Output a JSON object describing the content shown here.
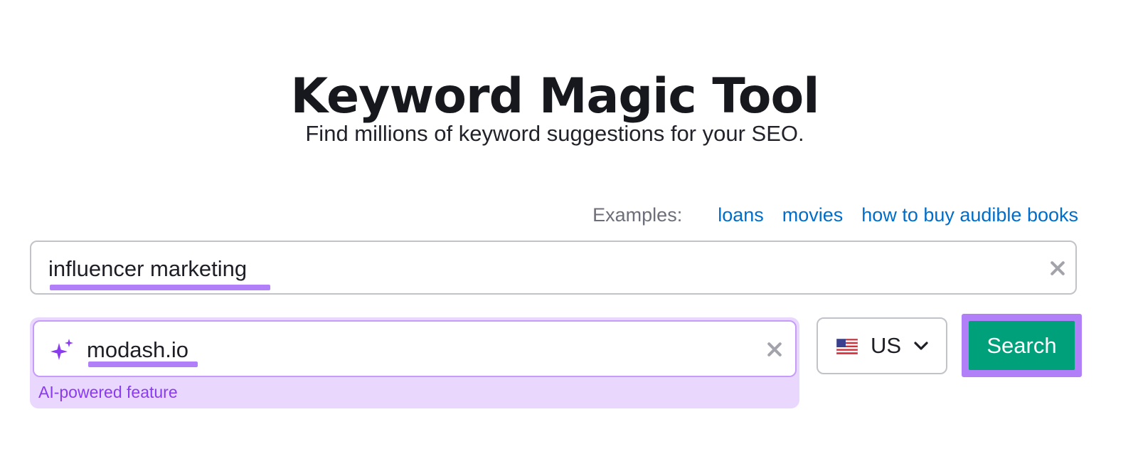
{
  "header": {
    "title": "Keyword Magic Tool",
    "subtitle": "Find millions of keyword suggestions for your SEO."
  },
  "examples": {
    "label": "Examples:",
    "links": [
      "loans",
      "movies",
      "how to buy audible books"
    ]
  },
  "keyword_input": {
    "value": "influencer marketing",
    "clear_icon": "close-icon"
  },
  "domain_input": {
    "value": "modash.io",
    "icon": "sparkle-icon",
    "clear_icon": "close-icon",
    "caption": "AI-powered feature"
  },
  "country_select": {
    "selected": "US",
    "flag_icon": "us-flag-icon",
    "chevron_icon": "chevron-down-icon"
  },
  "search_button": {
    "label": "Search"
  },
  "colors": {
    "accent_highlight": "#b17ff8",
    "ai_background": "#ead7fd",
    "ai_text": "#8a3bf0",
    "link": "#006dca",
    "search_button": "#00a07b"
  }
}
